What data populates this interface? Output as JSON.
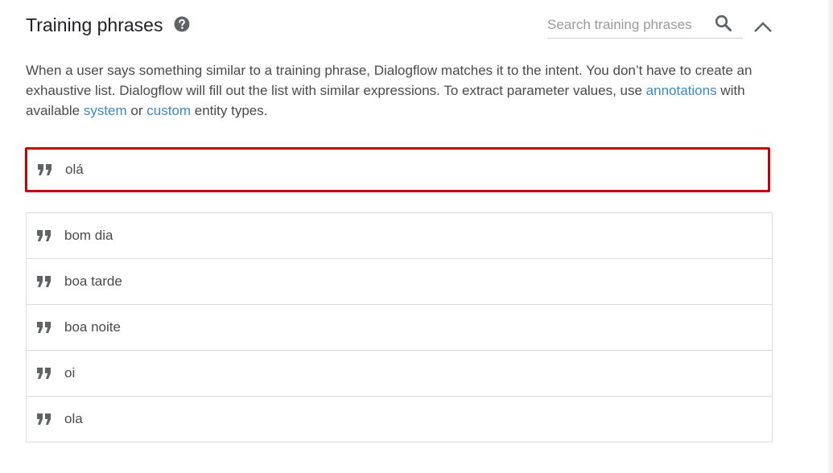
{
  "section": {
    "title": "Training phrases",
    "search_placeholder": "Search training phrases",
    "description": {
      "part1": "When a user says something similar to a training phrase, Dialogflow matches it to the intent. You don’t have to create an exhaustive list. Dialogflow will fill out the list with similar expressions. To extract parameter values, use ",
      "link_annotations": "annotations",
      "part2": " with available ",
      "link_system": "system",
      "part3": " or ",
      "link_custom": "custom",
      "part4": " entity types."
    }
  },
  "new_phrase": {
    "value": "olá"
  },
  "phrases": [
    {
      "text": "bom dia"
    },
    {
      "text": "boa tarde"
    },
    {
      "text": "boa noite"
    },
    {
      "text": "oi"
    },
    {
      "text": "ola"
    }
  ],
  "icons": {
    "help": "question-circle-icon",
    "search": "search-icon",
    "collapse": "chevron-up-icon",
    "quote": "quote-icon"
  },
  "colors": {
    "link": "#3d87c6",
    "highlight_border": "#c4000b",
    "icon": "#5f6368"
  }
}
